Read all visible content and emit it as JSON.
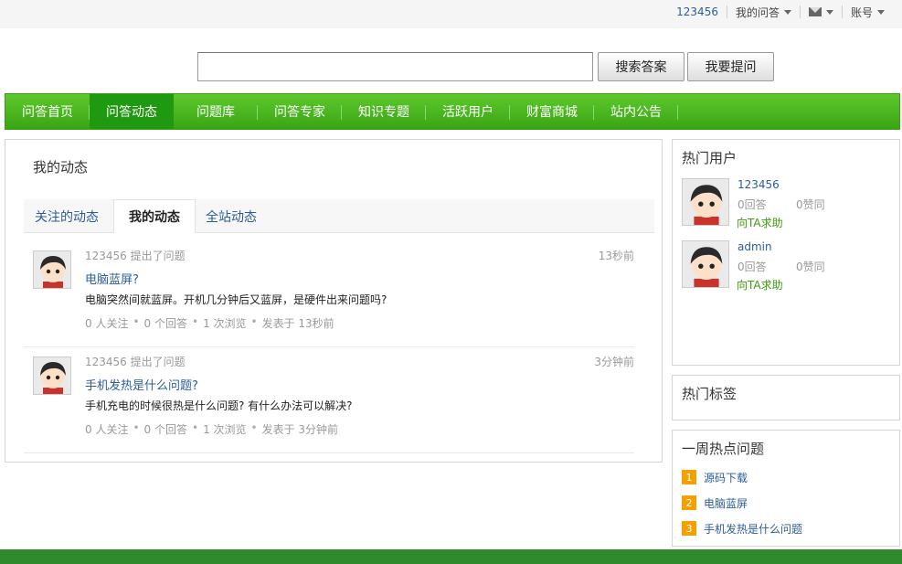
{
  "topbar": {
    "username": "123456",
    "my_qa": "我的问答",
    "account": "账号"
  },
  "search": {
    "placeholder": "",
    "search_label": "搜索答案",
    "ask_label": "我要提问"
  },
  "nav": {
    "items": [
      {
        "label": "问答首页",
        "active": false
      },
      {
        "label": "问答动态",
        "active": true
      },
      {
        "label": "问题库",
        "active": false
      },
      {
        "label": "问答专家",
        "active": false
      },
      {
        "label": "知识专题",
        "active": false
      },
      {
        "label": "活跃用户",
        "active": false
      },
      {
        "label": "财富商城",
        "active": false
      },
      {
        "label": "站内公告",
        "active": false
      }
    ]
  },
  "main": {
    "title": "我的动态",
    "tabs": [
      {
        "label": "关注的动态"
      },
      {
        "label": "我的动态"
      },
      {
        "label": "全站动态"
      }
    ],
    "feed": [
      {
        "meta": "123456 提出了问题",
        "time": "13秒前",
        "title": "电脑蓝屏?",
        "desc": "电脑突然间就蓝屏。开机几分钟后又蓝屏，是硬件出来问题吗?",
        "follows": "0 人关注",
        "answers": "0 个回答",
        "views": "1 次浏览",
        "posted": "发表于 13秒前"
      },
      {
        "meta": "123456 提出了问题",
        "time": "3分钟前",
        "title": "手机发热是什么问题?",
        "desc": "手机充电的时候很热是什么问题? 有什么办法可以解决?",
        "follows": "0 人关注",
        "answers": "0 个回答",
        "views": "1 次浏览",
        "posted": "发表于 3分钟前"
      }
    ]
  },
  "sidebar": {
    "hot_users_title": "热门用户",
    "hot_users": [
      {
        "name": "123456",
        "answers": "0回答",
        "likes": "0赞同",
        "help": "向TA求助"
      },
      {
        "name": "admin",
        "answers": "0回答",
        "likes": "0赞同",
        "help": "向TA求助"
      }
    ],
    "hot_tags_title": "热门标签",
    "weekly_title": "一周热点问题",
    "weekly": [
      {
        "rank": "1",
        "label": "源码下载"
      },
      {
        "rank": "2",
        "label": "电脑蓝屏"
      },
      {
        "rank": "3",
        "label": "手机发热是什么问题"
      }
    ]
  },
  "colors": {
    "nav_green": "#3aa514",
    "nav_active": "#1f9a10",
    "link_blue": "#2b5d99",
    "rank_orange": "#f4a000",
    "footer_green": "#2f8a2e"
  }
}
